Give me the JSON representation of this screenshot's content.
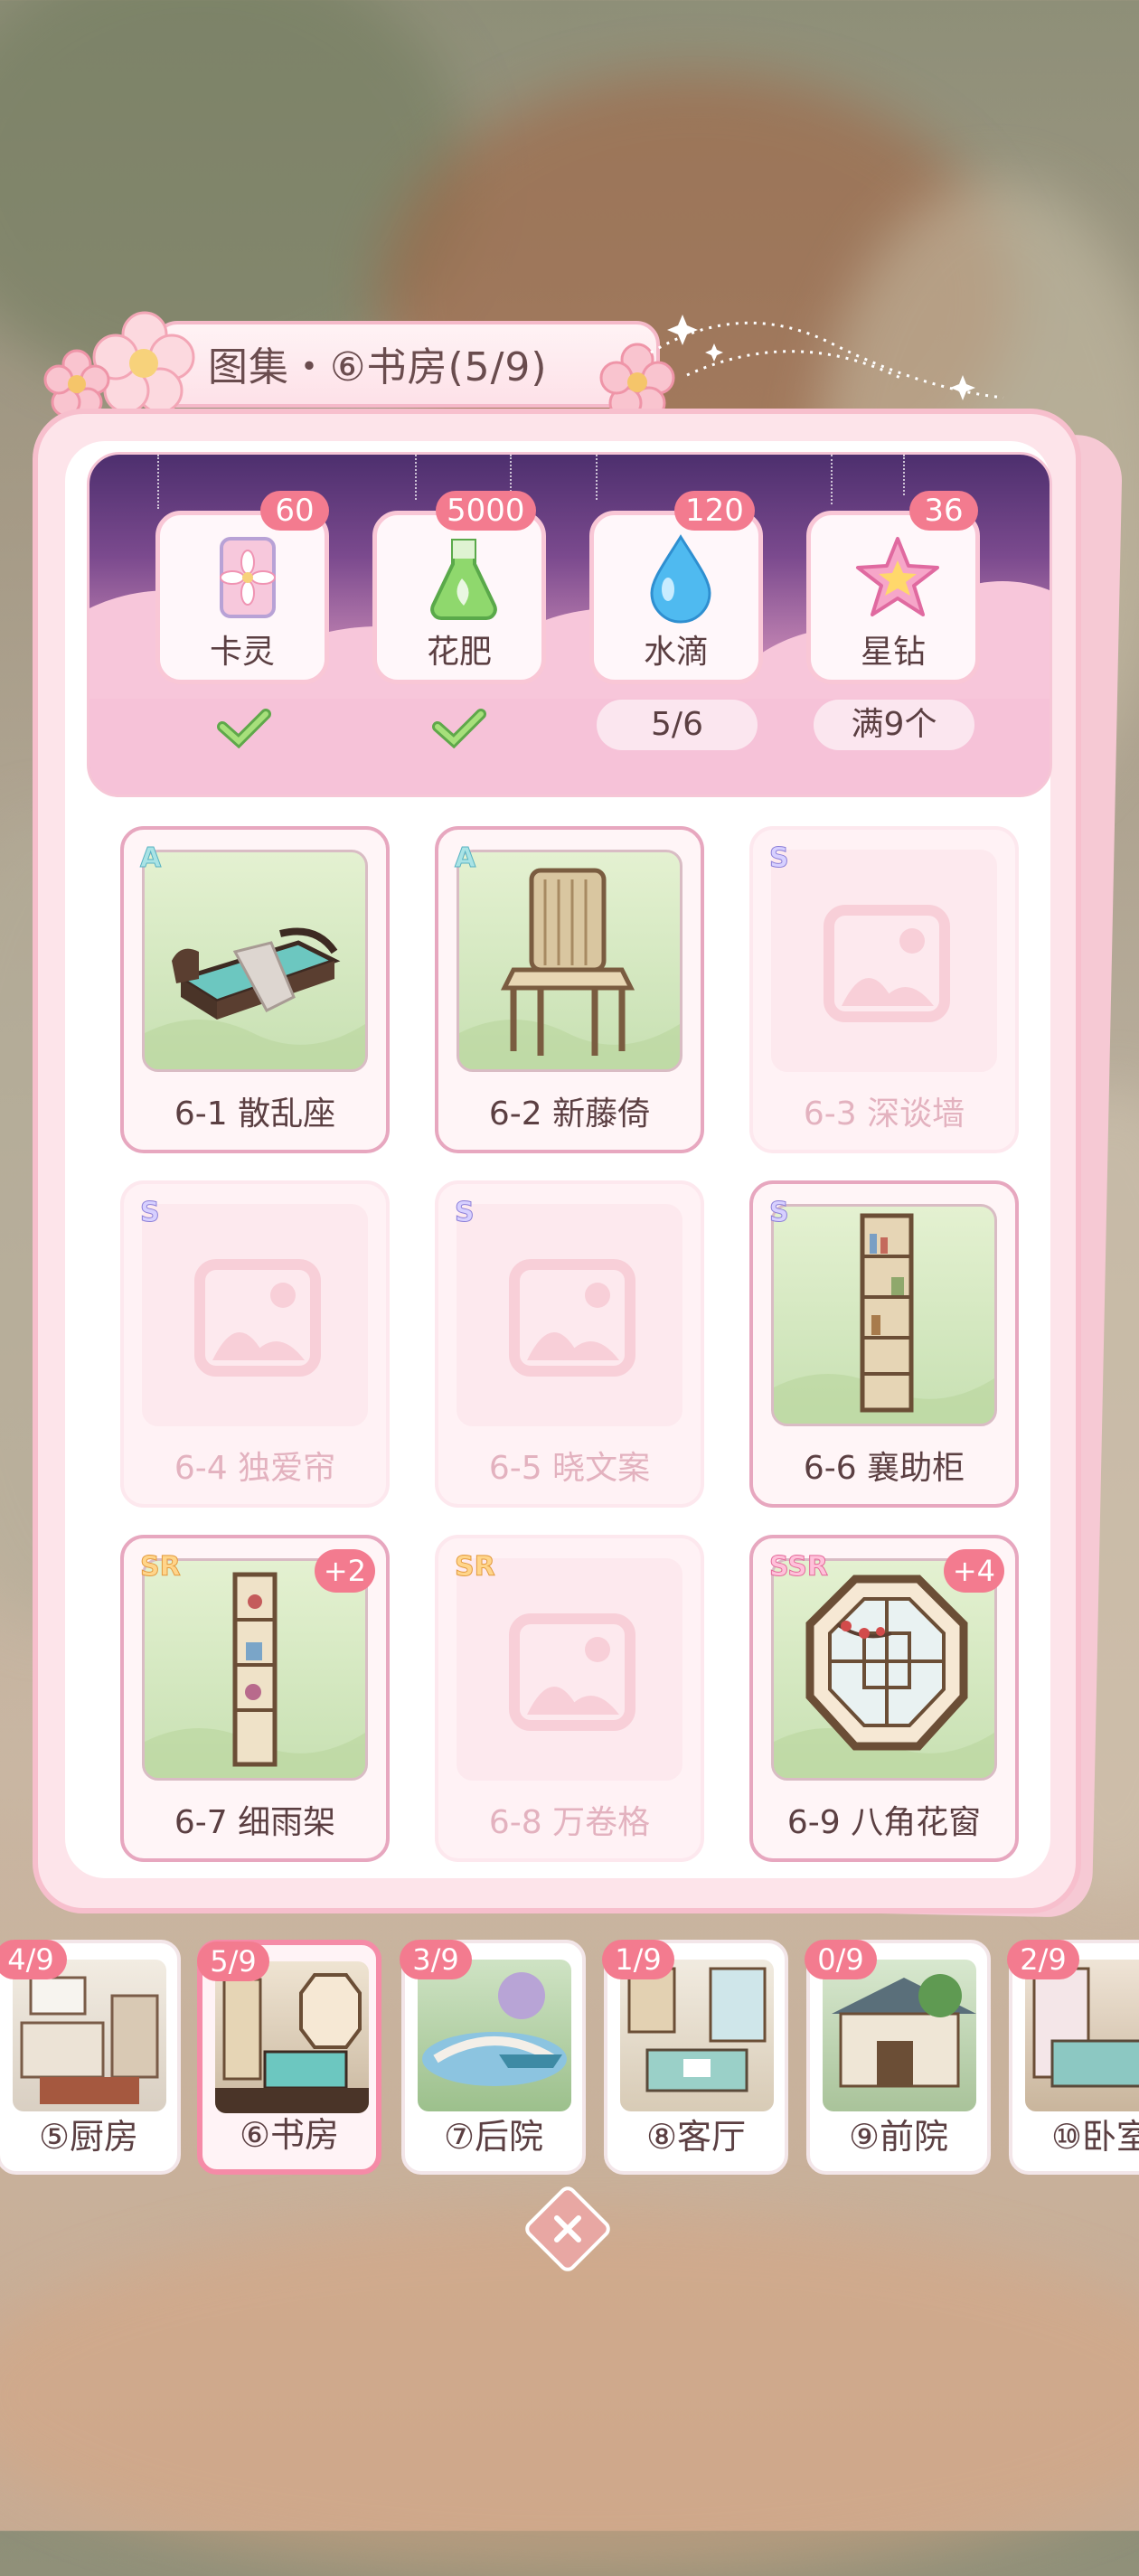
{
  "window": {
    "title": "图集・⑥书房(5/9)"
  },
  "rewards": [
    {
      "name": "卡灵",
      "count": "60",
      "icon": "card-spirit-icon",
      "status": "claimed"
    },
    {
      "name": "花肥",
      "count": "5000",
      "icon": "fertilizer-flask-icon",
      "status": "claimed"
    },
    {
      "name": "水滴",
      "count": "120",
      "icon": "water-drop-icon",
      "status": "progress",
      "progress": "5/6"
    },
    {
      "name": "星钻",
      "count": "36",
      "icon": "star-diamond-icon",
      "status": "progress",
      "progress": "满9个"
    }
  ],
  "items": [
    {
      "name": "6-1 散乱座",
      "rarity": "A",
      "locked": false,
      "bonus": ""
    },
    {
      "name": "6-2 新藤倚",
      "rarity": "A",
      "locked": false,
      "bonus": ""
    },
    {
      "name": "6-3 深谈墙",
      "rarity": "S",
      "locked": true,
      "bonus": ""
    },
    {
      "name": "6-4 独爱帘",
      "rarity": "S",
      "locked": true,
      "bonus": ""
    },
    {
      "name": "6-5 晓文案",
      "rarity": "S",
      "locked": true,
      "bonus": ""
    },
    {
      "name": "6-6 襄助柜",
      "rarity": "S",
      "locked": false,
      "bonus": ""
    },
    {
      "name": "6-7 细雨架",
      "rarity": "SR",
      "locked": false,
      "bonus": "+2"
    },
    {
      "name": "6-8 万卷格",
      "rarity": "SR",
      "locked": true,
      "bonus": ""
    },
    {
      "name": "6-9 八角花窗",
      "rarity": "SSR",
      "locked": false,
      "bonus": "+4"
    }
  ],
  "rooms": [
    {
      "name": "⑤厨房",
      "progress": "4/9",
      "active": false
    },
    {
      "name": "⑥书房",
      "progress": "5/9",
      "active": true
    },
    {
      "name": "⑦后院",
      "progress": "3/9",
      "active": false
    },
    {
      "name": "⑧客厅",
      "progress": "1/9",
      "active": false
    },
    {
      "name": "⑨前院",
      "progress": "0/9",
      "active": false
    },
    {
      "name": "⑩卧室",
      "progress": "2/9",
      "active": false
    }
  ],
  "colors": {
    "accent_pink": "#f37b8f",
    "panel_pink": "#fde4ea",
    "banner_purple": "#4d2f6e",
    "check_green": "#8fd36a"
  },
  "close_icon": "close-icon"
}
